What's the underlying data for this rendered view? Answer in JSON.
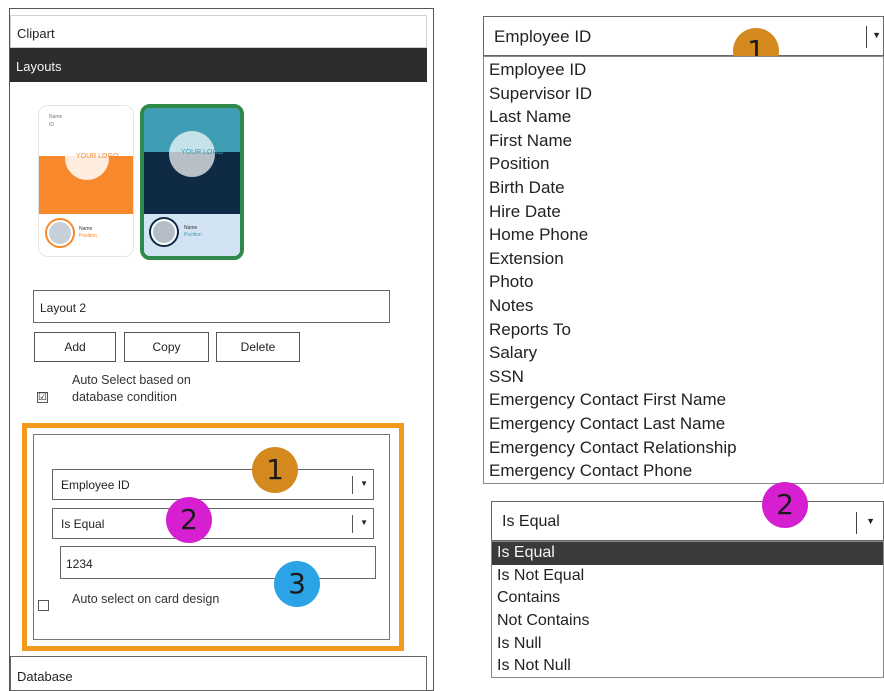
{
  "left_panel": {
    "clipart_header": "Clipart",
    "layouts_header": "Layouts",
    "thumb1": {
      "name_lines": [
        "Name",
        "ID"
      ],
      "logo": "YOUR LOGO",
      "footer": [
        "Name",
        "Position"
      ]
    },
    "thumb2": {
      "logo": "YOUR LOGO",
      "footer": [
        "Name",
        "Position"
      ]
    },
    "layout_name": "Layout 2",
    "buttons": {
      "add": "Add",
      "copy": "Copy",
      "delete": "Delete"
    },
    "auto_select_db": {
      "checked": true,
      "check_mark": "☑",
      "label": "Auto Select based on database condition"
    },
    "condition": {
      "field": "Employee ID",
      "operator": "Is Equal",
      "value": "1234"
    },
    "auto_select_card": {
      "checked": false,
      "label": "Auto select on card design"
    },
    "database_header": "Database",
    "badges": [
      "1",
      "2",
      "3"
    ]
  },
  "right_field_dropdown": {
    "selected": "Employee ID",
    "badge": "1",
    "options": [
      "Employee ID",
      "Supervisor ID",
      "Last Name",
      "First Name",
      "Position",
      "Birth Date",
      "Hire Date",
      "Home Phone",
      "Extension",
      "Photo",
      "Notes",
      "Reports To",
      "Salary",
      "SSN",
      "Emergency Contact First Name",
      "Emergency Contact Last Name",
      "Emergency Contact Relationship",
      "Emergency Contact Phone"
    ]
  },
  "right_op_dropdown": {
    "selected": "Is Equal",
    "badge": "2",
    "options": [
      "Is Equal",
      "Is Not Equal",
      "Contains",
      "Not Contains",
      "Is Null",
      "Is Not Null"
    ]
  },
  "colors": {
    "highlight_frame": "#f39a1e",
    "badge_orange": "#d4891f",
    "badge_purple": "#d51fd0",
    "badge_blue": "#2aa4e6",
    "header_dark": "#2d2d2d",
    "card2_border": "#2f8a4a"
  },
  "icons": {
    "dropdown": "chevron-down-icon",
    "checkbox": "checkbox-icon"
  }
}
